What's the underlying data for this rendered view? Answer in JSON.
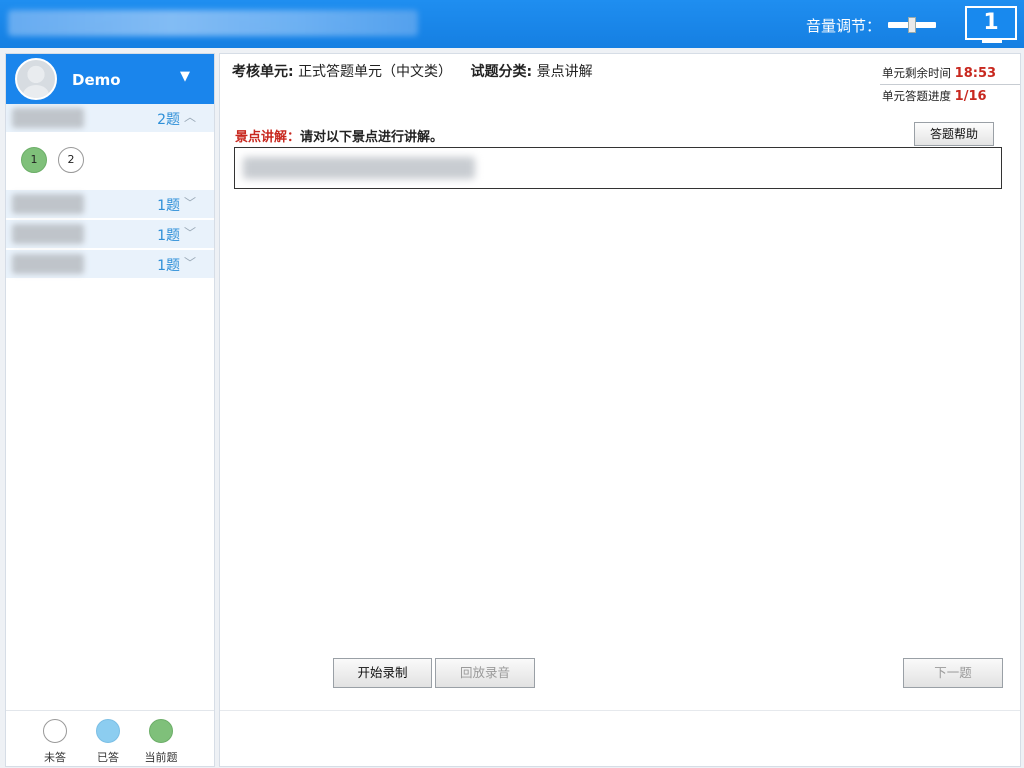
{
  "topbar": {
    "volume_label": "音量调节：",
    "screen_number": "1"
  },
  "sidebar": {
    "user_name": "Demo",
    "sections": [
      {
        "count": "2题",
        "expanded": true
      },
      {
        "count": "1题",
        "expanded": false
      },
      {
        "count": "1题",
        "expanded": false
      },
      {
        "count": "1题",
        "expanded": false
      }
    ],
    "questions": [
      {
        "number": "1",
        "state": "current"
      },
      {
        "number": "2",
        "state": "unanswered"
      }
    ],
    "legend": [
      {
        "label": "未答",
        "color": "#ffffff"
      },
      {
        "label": "已答",
        "color": "#8ccdf0"
      },
      {
        "label": "当前题",
        "color": "#7fc07a"
      }
    ]
  },
  "main": {
    "unit_label": "考核单元:",
    "unit_value": "正式答题单元（中文类）",
    "category_label": "试题分类:",
    "category_value": "景点讲解",
    "time_label": "单元剩余时间",
    "time_value": "18:53",
    "progress_label": "单元答题进度",
    "progress_value": "1/16",
    "question_tag": "景点讲解：",
    "question_prompt": "请对以下景点进行讲解。",
    "help_button": "答题帮助",
    "record_button": "开始录制",
    "playback_button": "回放录音",
    "next_button": "下一题"
  },
  "colors": {
    "topbar": "#1a87ee",
    "accent_red": "#c8281f",
    "count_blue": "#2d8fd8"
  }
}
